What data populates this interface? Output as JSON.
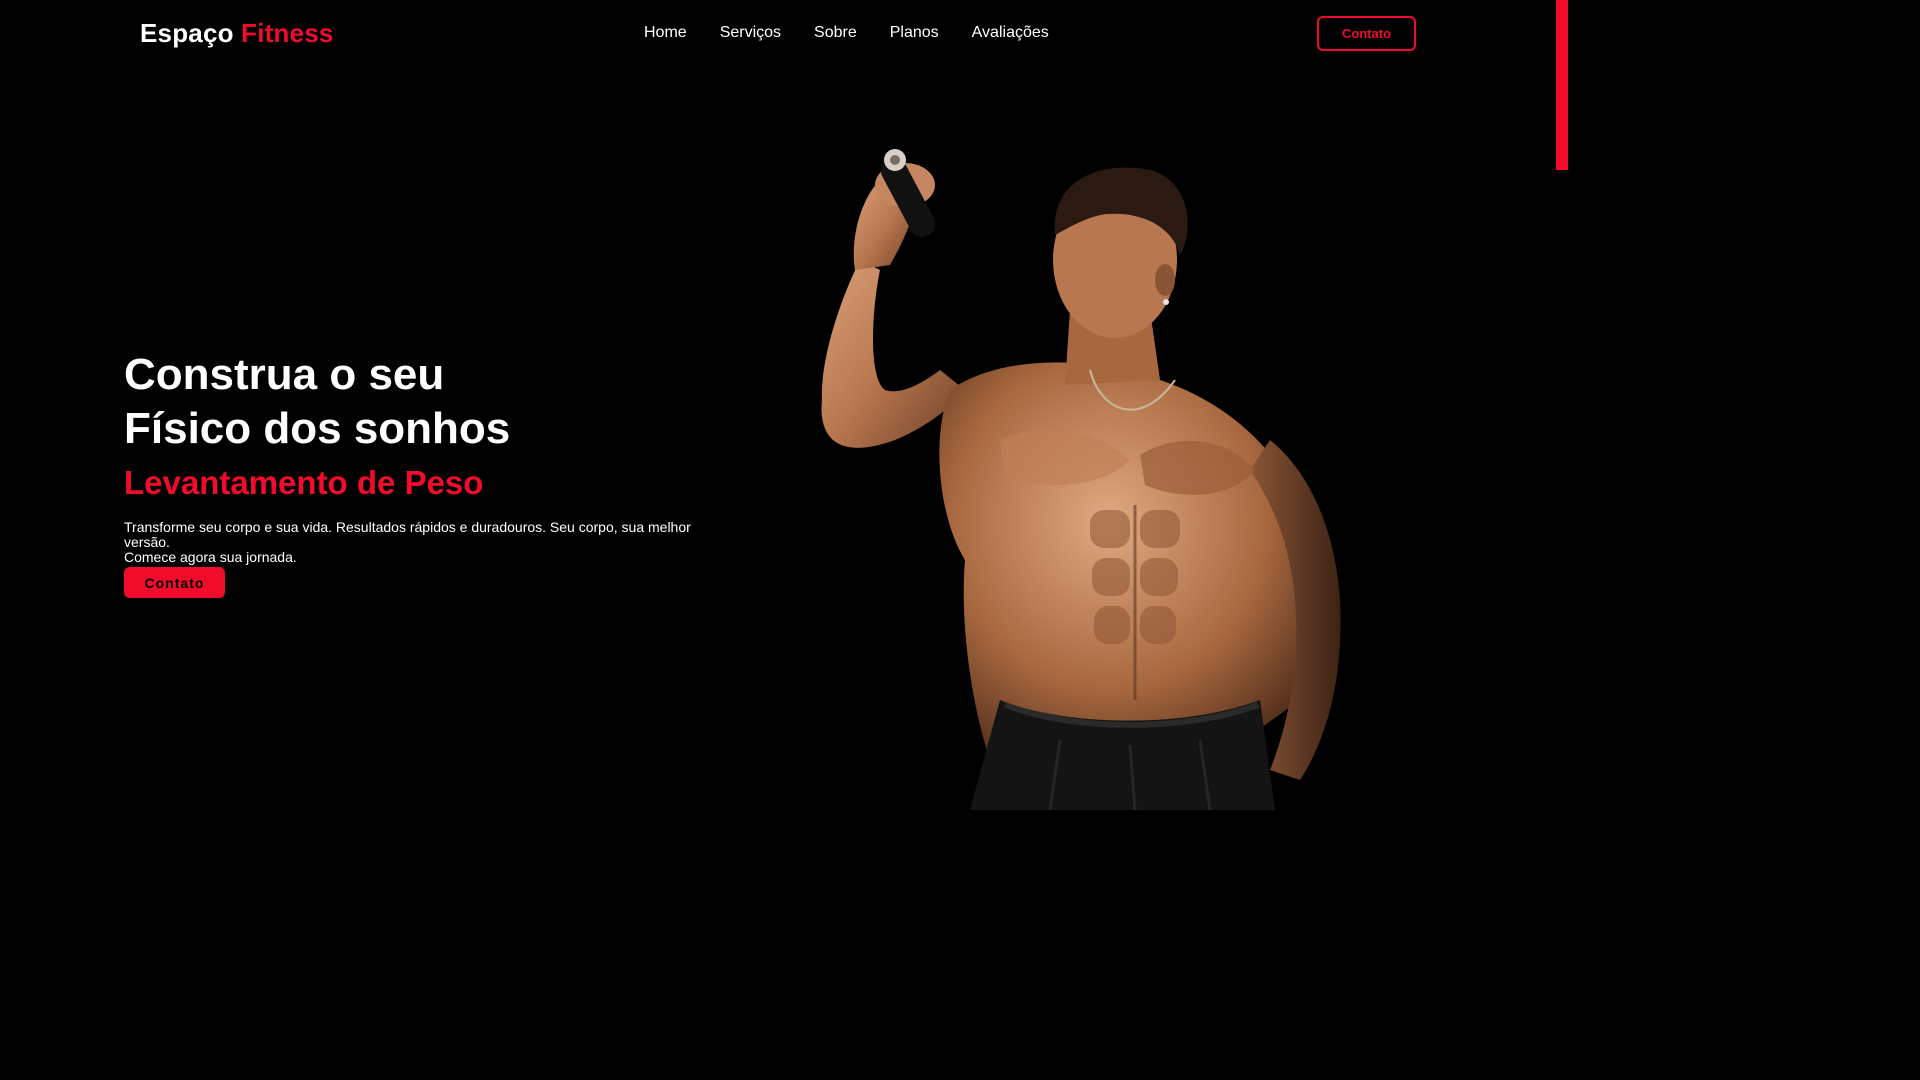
{
  "brand": {
    "name_part1": "Espaço",
    "name_part2": "Fitness"
  },
  "nav": {
    "items": [
      "Home",
      "Serviços",
      "Sobre",
      "Planos",
      "Avaliações"
    ]
  },
  "header": {
    "cta_label": "Contato"
  },
  "hero": {
    "title_line1": "Construa o seu",
    "title_line2": "Físico dos sonhos",
    "subtitle": "Levantamento de Peso",
    "description_line1": "Transforme seu corpo e sua vida. Resultados rápidos e duradouros. Seu corpo, sua melhor versão.",
    "description_line2": "Comece agora sua jornada.",
    "cta_label": "Contato"
  },
  "colors": {
    "accent": "#f20c2c",
    "background": "#000000",
    "text": "#ffffff"
  },
  "scroll": {
    "position_fraction": 0.0
  }
}
